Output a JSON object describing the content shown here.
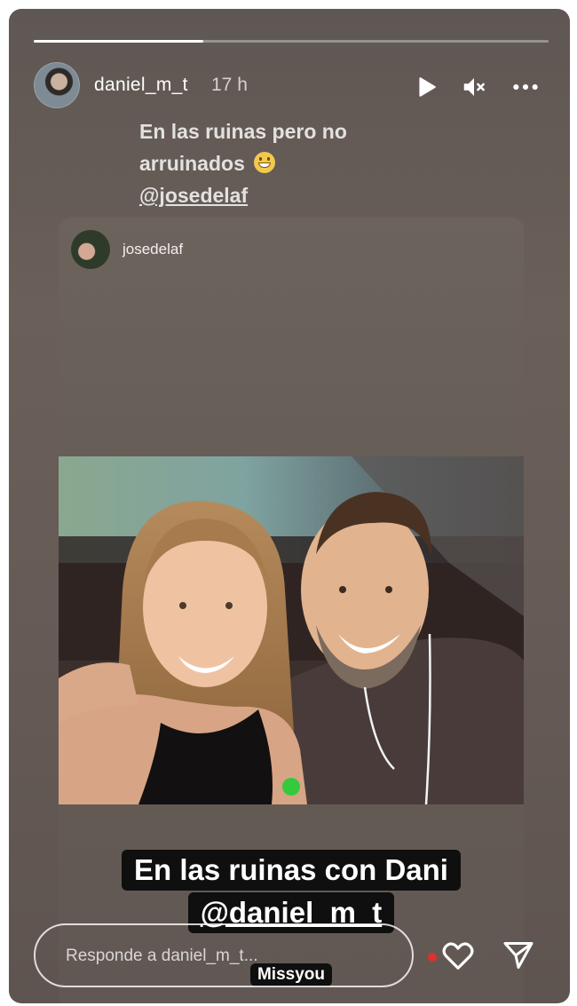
{
  "story": {
    "progress": 0.33,
    "username": "daniel_m_t",
    "time_ago": "17 h",
    "caption": {
      "line1": "En las ruinas pero no",
      "line2": "arruinados",
      "emoji_name": "grinning-face-emoji",
      "mention": "@josedelaf"
    }
  },
  "shared_post": {
    "username": "josedelaf",
    "sticker_line1": "En las ruinas con Dani",
    "sticker_line2": "@daniel_m_t",
    "sticker_line3": "Missyou"
  },
  "reply": {
    "placeholder": "Responde a daniel_m_t..."
  },
  "icons": {
    "play": "play-icon",
    "mute": "mute-icon",
    "more": "more-options-icon",
    "like": "heart-icon",
    "share": "send-icon"
  },
  "colors": {
    "background": "#665c56",
    "text": "#ffffff",
    "notification_dot": "#e0302b"
  }
}
